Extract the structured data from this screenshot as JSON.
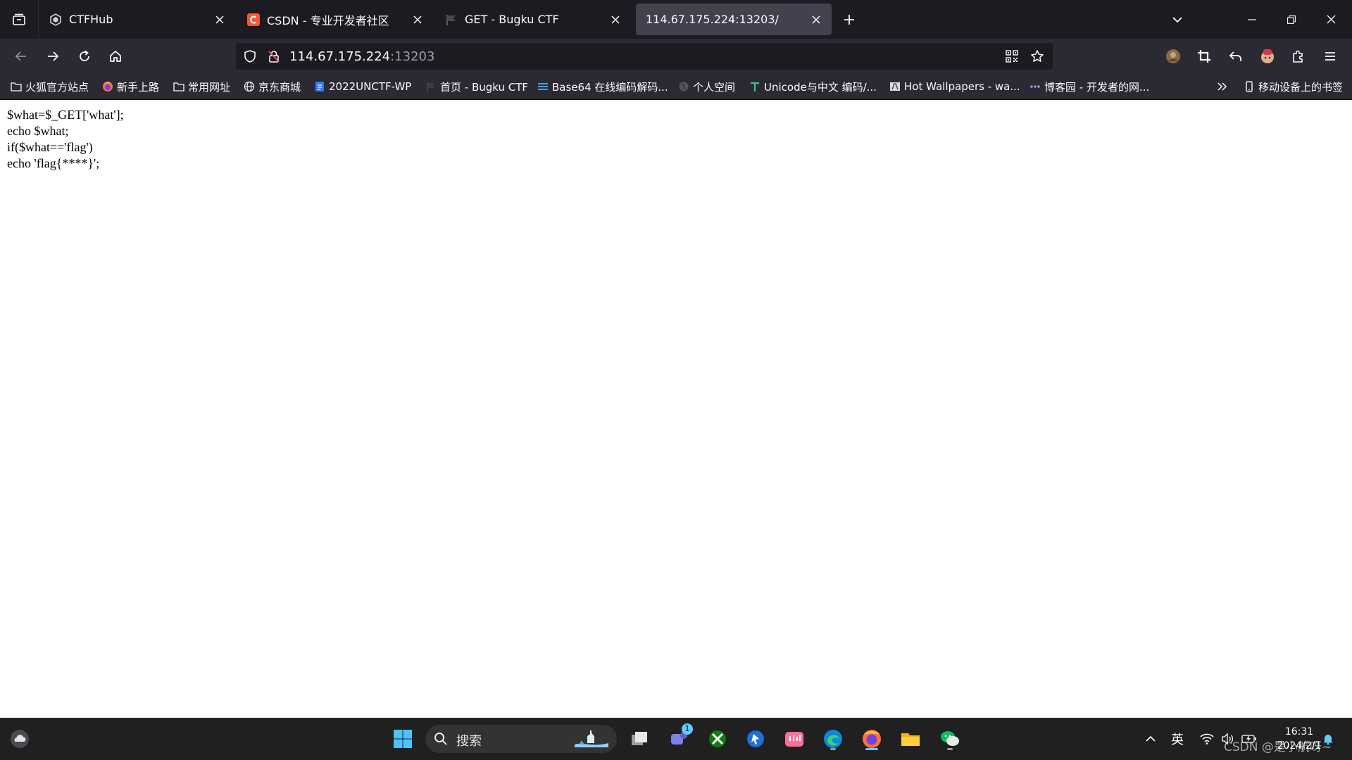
{
  "browser": {
    "tabs": [
      {
        "title": "CTFHub",
        "active": false
      },
      {
        "title": "CSDN - 专业开发者社区",
        "active": false
      },
      {
        "title": "GET - Bugku CTF",
        "active": false
      },
      {
        "title": "114.67.175.224:13203/",
        "active": true
      }
    ],
    "url": {
      "host": "114.67.175.224",
      "port": ":13203"
    },
    "bookmarks": [
      {
        "label": "火狐官方站点",
        "icon": "folder-icon"
      },
      {
        "label": "新手上路",
        "icon": "firefox-icon"
      },
      {
        "label": "常用网址",
        "icon": "folder-icon"
      },
      {
        "label": "京东商城",
        "icon": "globe-icon"
      },
      {
        "label": "2022UNCTF-WP",
        "icon": "document-icon"
      },
      {
        "label": "首页 - Bugku CTF",
        "icon": "flag-icon"
      },
      {
        "label": "Base64 在线编码解码...",
        "icon": "stack-icon"
      },
      {
        "label": "个人空间",
        "icon": "globe-icon"
      },
      {
        "label": "Unicode与中文 编码/...",
        "icon": "t-icon"
      },
      {
        "label": "Hot Wallpapers - wa...",
        "icon": "wallpaper-icon"
      },
      {
        "label": "博客园 - 开发者的网...",
        "icon": "cnblogs-icon"
      }
    ],
    "mobile_bookmarks": "移动设备上的书签"
  },
  "page": {
    "code_lines": [
      "$what=$_GET['what'];",
      "echo $what;",
      "if($what=='flag')",
      "echo 'flag{****}';"
    ]
  },
  "taskbar": {
    "search_label": "搜索",
    "chat_badge": "1",
    "ime": "英",
    "time": "16:31",
    "date": "2024/2/1",
    "watermark": "CSDN @是小航呀~"
  },
  "colors": {
    "tabbar": "#1c1b22",
    "toolbar": "#2b2a33",
    "active_tab": "#42414d",
    "taskbar": "#202020",
    "accent": "#60cdff"
  }
}
